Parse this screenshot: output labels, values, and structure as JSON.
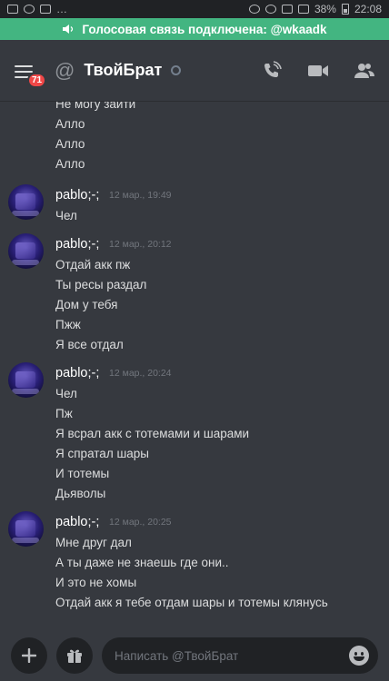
{
  "status_bar": {
    "battery": "38%",
    "time": "22:08"
  },
  "voice_banner": {
    "text": "Голосовая связь подключена: @wkaadk"
  },
  "header": {
    "badge": "71",
    "title": "ТвойБрат"
  },
  "messages": {
    "top_lines": [
      "Не могу зайти",
      "Алло",
      "Алло",
      "Алло"
    ],
    "groups": [
      {
        "author": "pablo;-;",
        "timestamp": "12 мар., 19:49",
        "lines": [
          "Чел"
        ]
      },
      {
        "author": "pablo;-;",
        "timestamp": "12 мар., 20:12",
        "lines": [
          "Отдай акк пж",
          "Ты ресы раздал",
          "Дом у тебя",
          "Пжж",
          "Я все отдал"
        ]
      },
      {
        "author": "pablo;-;",
        "timestamp": "12 мар., 20:24",
        "lines": [
          "Чел",
          "Пж",
          "Я всрал акк с тотемами и шарами",
          "Я спратал шары",
          "И тотемы",
          "Дьяволы"
        ]
      },
      {
        "author": "pablo;-;",
        "timestamp": "12 мар., 20:25",
        "lines": [
          "Мне друг дал",
          "А ты даже не знаешь где они..",
          "И это не хомы",
          "Отдай акк я тебе отдам шары и тотемы клянусь"
        ]
      }
    ]
  },
  "composer": {
    "placeholder": "Написать @ТвойБрат"
  },
  "colors": {
    "background": "#36393f",
    "voice_connected": "#43b581",
    "badge": "#f04747"
  }
}
